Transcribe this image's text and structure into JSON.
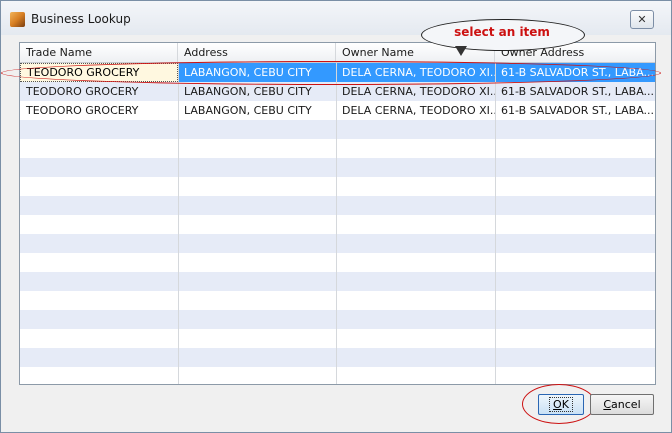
{
  "window": {
    "title": "Business Lookup",
    "close_label": "✕"
  },
  "grid": {
    "columns": [
      "Trade Name",
      "Address",
      "Owner Name",
      "Owner Address"
    ],
    "rows": [
      [
        "TEODORO GROCERY",
        "LABANGON, CEBU CITY",
        "DELA CERNA, TEODORO XI...",
        "61-B SALVADOR ST., LABA..."
      ],
      [
        "TEODORO GROCERY",
        "LABANGON, CEBU CITY",
        "DELA CERNA, TEODORO XI...",
        "61-B SALVADOR ST., LABA..."
      ],
      [
        "TEODORO GROCERY",
        "LABANGON, CEBU CITY",
        "DELA CERNA, TEODORO XI...",
        "61-B SALVADOR ST., LABA..."
      ]
    ],
    "selected_row": 0
  },
  "annotation": {
    "callout_text": "select an item",
    "color": "#cc1111"
  },
  "buttons": {
    "ok_mnemonic": "O",
    "ok_rest": "K",
    "cancel_mnemonic": "C",
    "cancel_rest": "ancel"
  },
  "colors": {
    "selection": "#3399ff",
    "alt_row": "#e6ebf7"
  }
}
